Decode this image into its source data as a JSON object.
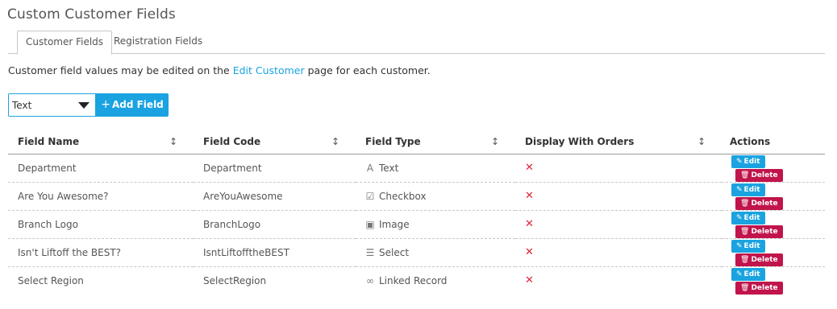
{
  "page": {
    "title": "Custom Customer Fields"
  },
  "tabs": [
    {
      "label": "Customer Fields",
      "active": true
    },
    {
      "label": "Registration Fields",
      "active": false
    }
  ],
  "info": {
    "prefix": "Customer field values may be edited on the ",
    "link": "Edit Customer",
    "suffix": " page for each customer."
  },
  "toolbar": {
    "type_select_value": "Text",
    "add_field_label": "Add Field"
  },
  "table": {
    "headers": {
      "field_name": "Field Name",
      "field_code": "Field Code",
      "field_type": "Field Type",
      "display_with_orders": "Display With Orders",
      "actions": "Actions"
    },
    "rows": [
      {
        "name": "Department",
        "code": "Department",
        "type": "Text",
        "type_icon": "text-icon",
        "display": "✕"
      },
      {
        "name": "Are You Awesome?",
        "code": "AreYouAwesome",
        "type": "Checkbox",
        "type_icon": "checkbox-icon",
        "display": "✕"
      },
      {
        "name": "Branch Logo",
        "code": "BranchLogo",
        "type": "Image",
        "type_icon": "image-icon",
        "display": "✕"
      },
      {
        "name": "Isn't Liftoff the BEST?",
        "code": "IsntLiftofftheBEST",
        "type": "Select",
        "type_icon": "list-icon",
        "display": "✕"
      },
      {
        "name": "Select Region",
        "code": "SelectRegion",
        "type": "Linked Record",
        "type_icon": "link-icon",
        "display": "✕"
      }
    ],
    "edit_label": "Edit",
    "delete_label": "Delete"
  },
  "colors": {
    "accent": "#1aa3e0",
    "danger": "#c0144a",
    "x_mark": "#e0243a"
  }
}
